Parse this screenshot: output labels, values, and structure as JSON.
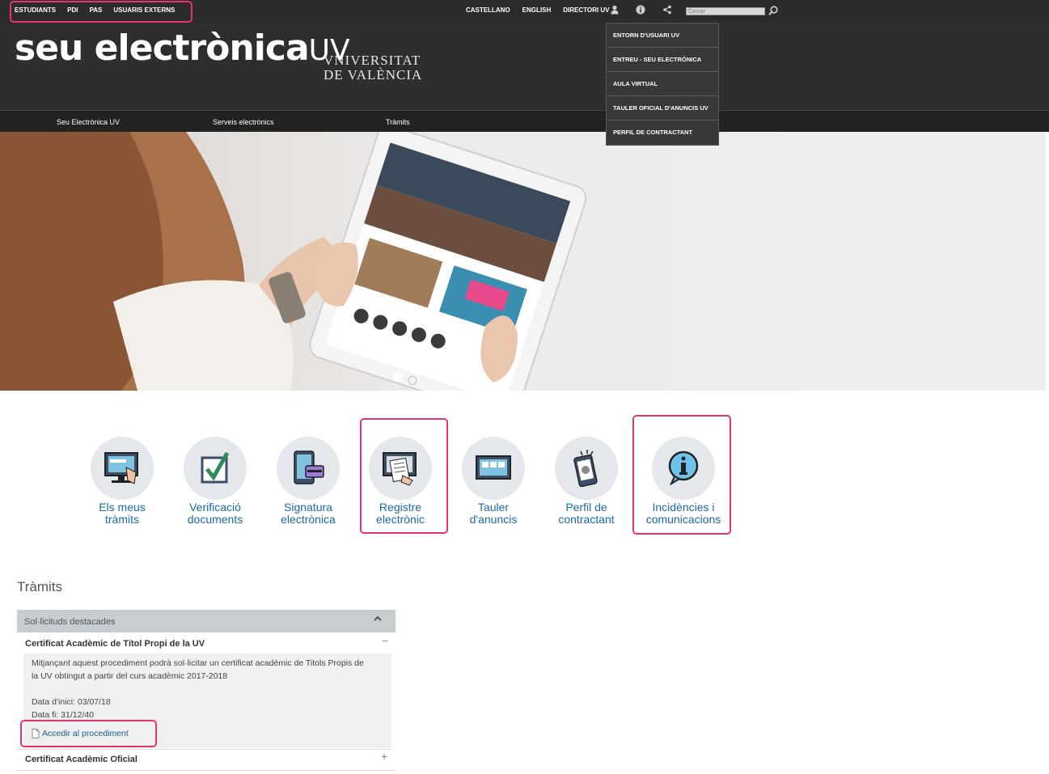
{
  "topbar": {
    "left_links": [
      "ESTUDIANTS",
      "PDI",
      "PAS",
      "USUARIS EXTERNS"
    ],
    "right_links": [
      "CASTELLANO",
      "ENGLISH",
      "DIRECTORI UV"
    ],
    "search_placeholder": "Cercar"
  },
  "header": {
    "logo_main": "seu electrònica",
    "logo_suffix": "UV",
    "university_line1": "VNIVERSITAT",
    "university_line2": "DE VALÈNCIA"
  },
  "nav": {
    "items": [
      "Seu Electrònica UV",
      "Serveis electrònics",
      "Tràmits"
    ]
  },
  "dropdown": {
    "items": [
      "ENTORN D'USUARI UV",
      "ENTREU - SEU ELECTRÒNICA",
      "AULA VIRTUAL",
      "TAULER OFICIAL D'ANUNCIS UV",
      "PERFIL DE CONTRACTANT"
    ]
  },
  "services": [
    {
      "line1": "Els meus",
      "line2": "tràmits",
      "icon": "monitor-hand-icon"
    },
    {
      "line1": "Verificació",
      "line2": "documents",
      "icon": "checkbox-icon"
    },
    {
      "line1": "Signatura",
      "line2": "electrònica",
      "icon": "tablet-card-icon"
    },
    {
      "line1": "Registre",
      "line2": "electrònic",
      "icon": "monitor-document-icon"
    },
    {
      "line1": "Tauler",
      "line2": "d'anuncis",
      "icon": "noticeboard-icon"
    },
    {
      "line1": "Perfil de",
      "line2": "contractant",
      "icon": "phone-alert-icon"
    },
    {
      "line1": "Incidències i",
      "line2": "comunicacions",
      "icon": "info-bubble-icon"
    }
  ],
  "tramits": {
    "title": "Tràmits",
    "panel_title": "Sol·licituds destacades",
    "item1_title": "Certificat Acadèmic de Títol Propi de la UV",
    "item1_desc_line1": "Mitjançant aquest procediment podrà sol·licitar un certificat acadèmic de Titols Propis de",
    "item1_desc_line2": "la UV obtingut a partir del curs acadèmic 2017-2018",
    "start_date": "Data d'inici: 03/07/18",
    "end_date": "Data fi: 31/12/40",
    "access_link": "Accedir al procediment",
    "item2_title": "Certificat Acadèmic Oficial"
  },
  "colors": {
    "accent_link": "#1a6aa8",
    "highlight": "#e8336d",
    "header_bg": "#2e2e2e"
  }
}
